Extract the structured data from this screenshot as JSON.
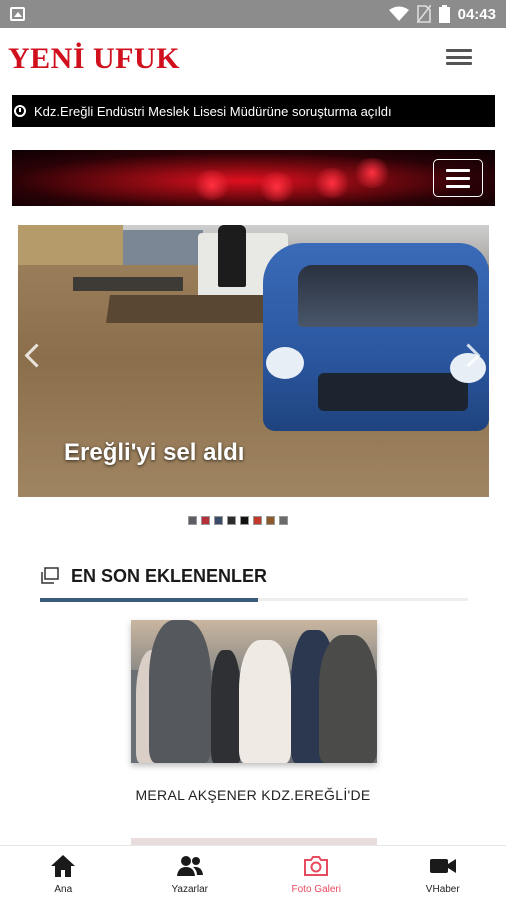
{
  "status_bar": {
    "time": "04:43"
  },
  "app": {
    "logo": "YENİ UFUK"
  },
  "ticker": {
    "headline": "Kdz.Ereğli Endüstri Meslek Lisesi Müdürüne soruşturma açıldı"
  },
  "slider": {
    "caption": "Ereğli'yi sel aldı",
    "thumb_count": 8,
    "active_index": 0
  },
  "section": {
    "title": "EN SON EKLENENLER"
  },
  "cards": [
    {
      "title": "MERAL AKŞENER KDZ.EREĞLİ'DE"
    }
  ],
  "tabs": [
    {
      "label": "Ana",
      "icon": "home-icon"
    },
    {
      "label": "Yazarlar",
      "icon": "users-icon"
    },
    {
      "label": "Foto Galeri",
      "icon": "camera-icon",
      "active": true
    },
    {
      "label": "VHaber",
      "icon": "video-icon"
    }
  ],
  "colors": {
    "brand": "#d0101d",
    "active_tab": "#e84a5f",
    "section_bar": "#3c5a7a"
  }
}
